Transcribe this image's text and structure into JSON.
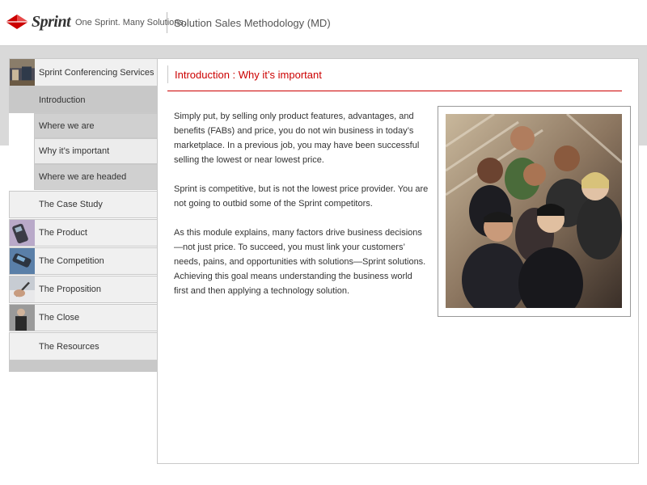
{
  "header": {
    "brand": "Sprint",
    "tagline": "One Sprint. Many Solutions.",
    "app_title": "Solution Sales Methodology (MD)",
    "brand_color": "#cc0000"
  },
  "sidebar": {
    "course_item": {
      "label": "Sprint Conferencing Services",
      "icon": "conference-room-thumbnail"
    },
    "sections": [
      {
        "label": "Introduction",
        "active": true,
        "icon": ""
      },
      {
        "label": "The Case Study",
        "icon": ""
      },
      {
        "label": "The Product",
        "icon": "mobile-phone-thumbnail"
      },
      {
        "label": "The Competition",
        "icon": "handset-thumbnail"
      },
      {
        "label": "The Proposition",
        "icon": "writing-thumbnail"
      },
      {
        "label": "The Close",
        "icon": "person-thumbnail"
      },
      {
        "label": "The Resources",
        "icon": ""
      }
    ],
    "sub_items": [
      {
        "label": "Where we are"
      },
      {
        "label": "Why it’s important"
      },
      {
        "label": "Where we are headed"
      }
    ]
  },
  "main": {
    "page_title": "Introduction : Why it’s important",
    "paragraphs": [
      "Simply put, by selling only product features, advantages, and benefits (FABs) and price, you do not win business in today’s marketplace. In a previous job, you may have been successful selling the lowest or near lowest price.",
      "Sprint is competitive, but is not the lowest price provider. You are not going to outbid some of the Sprint competitors.",
      "As this module explains, many factors drive business decisions—not just price. To succeed, you must link your customers’ needs, pains, and opportunities with solutions—Sprint solutions. Achieving this goal means understanding the business world first and then applying a technology solution."
    ],
    "photo": "group-of-business-people-photo"
  }
}
